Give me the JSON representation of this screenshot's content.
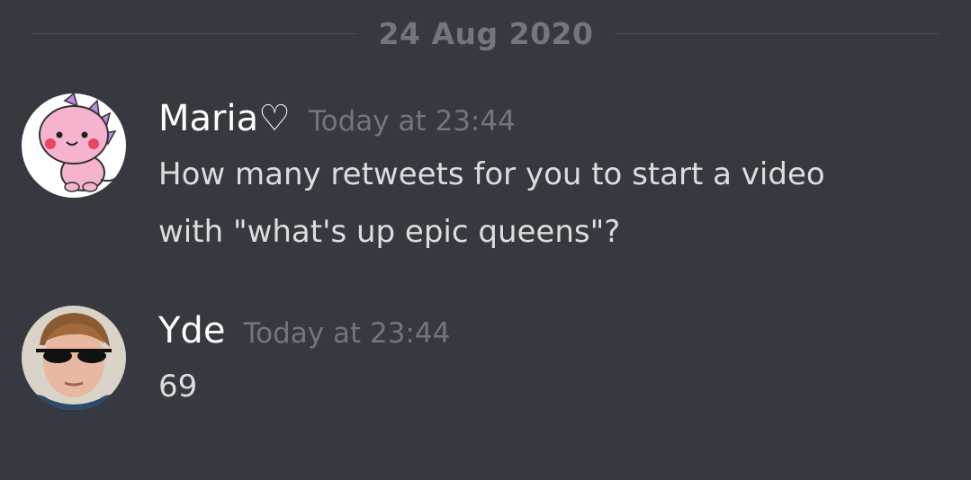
{
  "date_divider": "24 Aug 2020",
  "messages": [
    {
      "username": "Maria♡",
      "timestamp": "Today at 23:44",
      "lines": [
        "How many retweets for you to start a video",
        "with \"what's up epic queens\"?"
      ]
    },
    {
      "username": "Yde",
      "timestamp": "Today at 23:44",
      "lines": [
        "69"
      ]
    }
  ],
  "colors": {
    "background": "#36393f",
    "username": "#ffffff",
    "timestamp": "#72767d",
    "message_text": "#dcddde",
    "divider": "#4f535a"
  }
}
